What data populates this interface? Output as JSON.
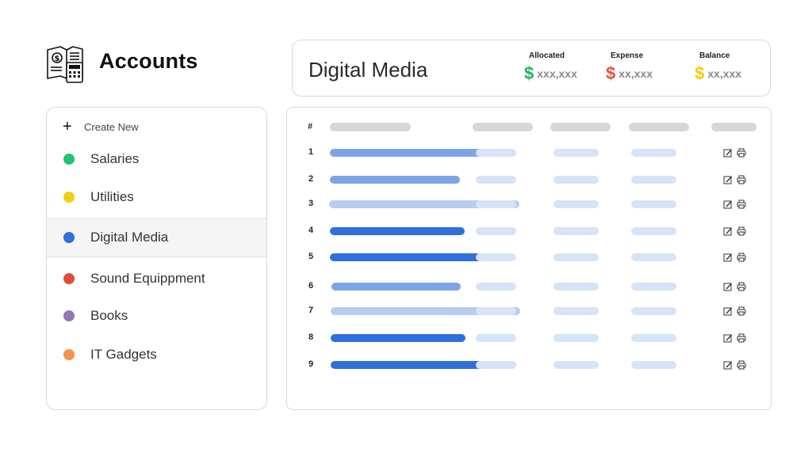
{
  "app": {
    "title": "Accounts",
    "logo_icon": "accounting-book-calculator-icon"
  },
  "header": {
    "title": "Digital Media",
    "stats": [
      {
        "label": "Allocated",
        "value": "xxx,xxx",
        "symbol": "$",
        "color": "#22b35d"
      },
      {
        "label": "Expense",
        "value": "xx,xxx",
        "symbol": "$",
        "color": "#e5533d"
      },
      {
        "label": "Balance",
        "value": "xx,xxx",
        "symbol": "$",
        "color": "#f2cc0c"
      }
    ]
  },
  "sidebar": {
    "create_label": "Create New",
    "create_icon": "plus-icon",
    "items": [
      {
        "label": "Salaries",
        "color": "#1ec46e",
        "active": false
      },
      {
        "label": "Utilities",
        "color": "#f2cf0f",
        "active": false
      },
      {
        "label": "Digital Media",
        "color": "#2e6fde",
        "active": true
      },
      {
        "label": "Sound Equippment",
        "color": "#e24c3c",
        "active": false
      },
      {
        "label": "Books",
        "color": "#9079b5",
        "active": false
      },
      {
        "label": "IT Gadgets",
        "color": "#f5924a",
        "active": false
      }
    ]
  },
  "table": {
    "header_hash": "#",
    "rows": [
      "1",
      "2",
      "3",
      "4",
      "5",
      "6",
      "7",
      "8",
      "9"
    ],
    "row_actions": [
      "edit-icon",
      "print-icon"
    ],
    "colors": {
      "light": "#b7cdf0",
      "medium": "#7ea4e8",
      "dark": "#2f6fdd",
      "cell": "#d6e3f8",
      "header": "#d7d7d7"
    }
  }
}
